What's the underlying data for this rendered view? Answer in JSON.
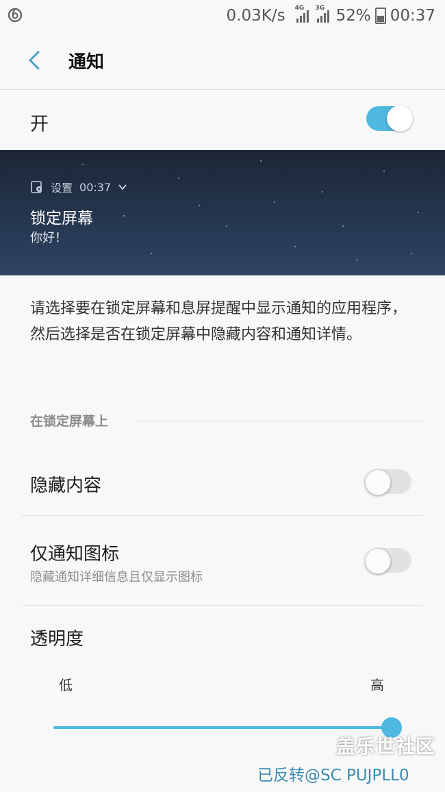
{
  "status_bar": {
    "speed": "0.03K/s",
    "net1": "4G",
    "net2": "3G",
    "battery": "52%",
    "time": "00:37"
  },
  "header": {
    "title": "通知"
  },
  "master_toggle": {
    "label": "开",
    "state": "on"
  },
  "preview": {
    "app_name": "设置",
    "time": "00:37",
    "title": "锁定屏幕",
    "body": "你好！"
  },
  "description": "请选择要在锁定屏幕和息屏提醒中显示通知的应用程序，然后选择是否在锁定屏幕中隐藏内容和通知详情。",
  "section_title": "在锁定屏幕上",
  "hide_content": {
    "label": "隐藏内容",
    "state": "off"
  },
  "icons_only": {
    "label": "仅通知图标",
    "subtitle": "隐藏通知详细信息且仅显示图标",
    "state": "off"
  },
  "transparency": {
    "label": "透明度",
    "low": "低",
    "high": "高",
    "value_percent": 100
  },
  "watermark": {
    "site": "盖乐世社区",
    "credit": "已反转@SC PUJPLL0"
  },
  "colors": {
    "accent": "#4fb8e0",
    "background": "#f8f8f8"
  }
}
